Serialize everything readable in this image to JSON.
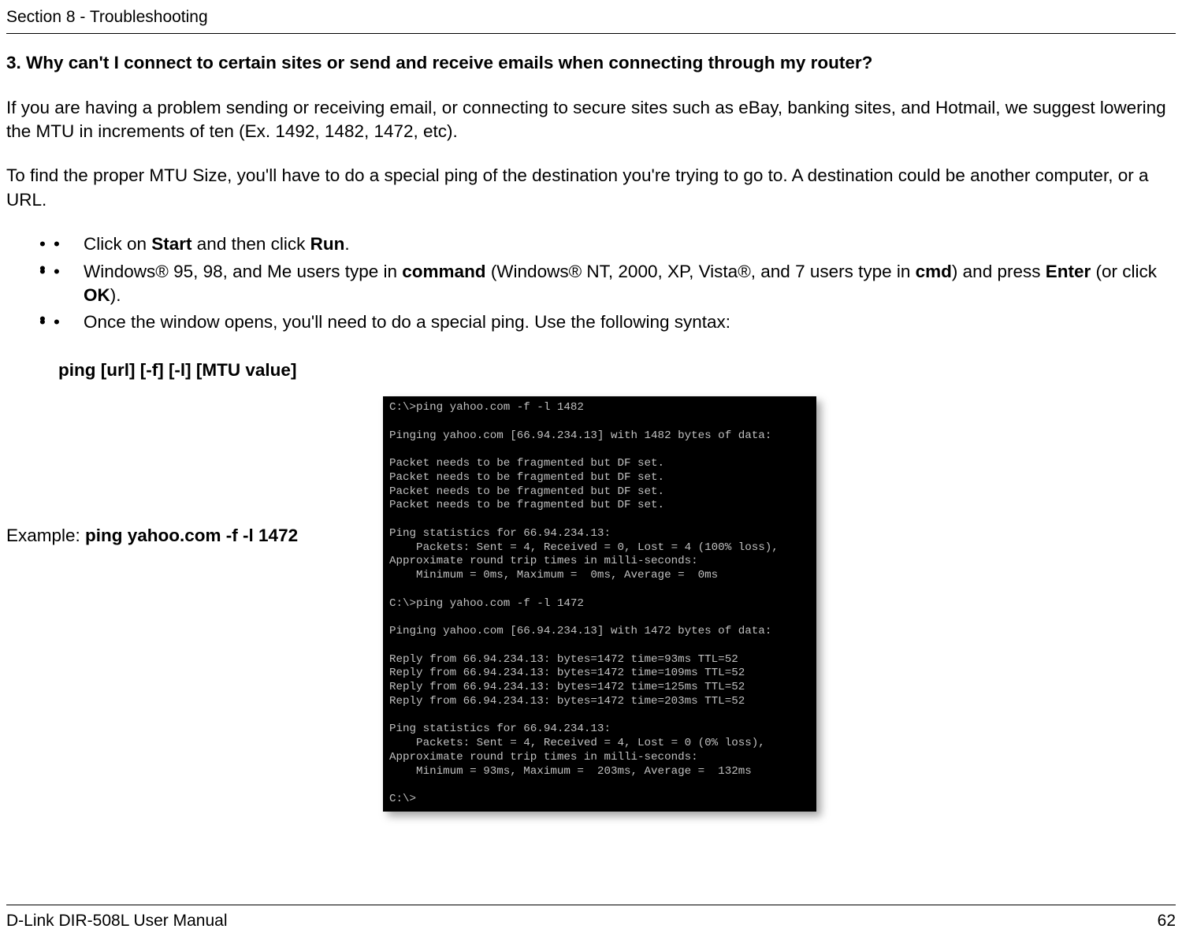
{
  "header": {
    "section": "Section 8 - Troubleshooting"
  },
  "question": "3. Why can't I connect to certain sites or send and receive emails when connecting through my router?",
  "para1": "If you are having a problem sending or receiving email, or connecting to secure sites such as eBay, banking sites, and Hotmail, we suggest lowering the MTU in increments of ten (Ex. 1492, 1482, 1472, etc).",
  "para2": "To find the proper MTU Size, you'll have to do a special ping of the destination you're trying to go to. A destination could be another computer, or a URL.",
  "bullets": {
    "b1_pre": "Click on ",
    "b1_start": "Start",
    "b1_mid": " and then click ",
    "b1_run": "Run",
    "b1_post": ".",
    "b2_pre": "Windows® 95, 98, and Me users type in ",
    "b2_cmd1": "command",
    "b2_mid": " (Windows® NT, 2000, XP, Vista®, and 7 users type in ",
    "b2_cmd2": "cmd",
    "b2_post1": ") and press ",
    "b2_enter": "Enter",
    "b2_or": " (or click ",
    "b2_ok": "OK",
    "b2_post2": ").",
    "b3": "Once the window opens, you'll need to do a special ping. Use the following syntax:"
  },
  "syntax": "ping [url] [-f] [-l] [MTU value]",
  "example_label": "Example: ",
  "example_cmd": "ping yahoo.com -f -l 1472",
  "terminal": "C:\\>ping yahoo.com -f -l 1482\n\nPinging yahoo.com [66.94.234.13] with 1482 bytes of data:\n\nPacket needs to be fragmented but DF set.\nPacket needs to be fragmented but DF set.\nPacket needs to be fragmented but DF set.\nPacket needs to be fragmented but DF set.\n\nPing statistics for 66.94.234.13:\n    Packets: Sent = 4, Received = 0, Lost = 4 (100% loss),\nApproximate round trip times in milli-seconds:\n    Minimum = 0ms, Maximum =  0ms, Average =  0ms\n\nC:\\>ping yahoo.com -f -l 1472\n\nPinging yahoo.com [66.94.234.13] with 1472 bytes of data:\n\nReply from 66.94.234.13: bytes=1472 time=93ms TTL=52\nReply from 66.94.234.13: bytes=1472 time=109ms TTL=52\nReply from 66.94.234.13: bytes=1472 time=125ms TTL=52\nReply from 66.94.234.13: bytes=1472 time=203ms TTL=52\n\nPing statistics for 66.94.234.13:\n    Packets: Sent = 4, Received = 4, Lost = 0 (0% loss),\nApproximate round trip times in milli-seconds:\n    Minimum = 93ms, Maximum =  203ms, Average =  132ms\n\nC:\\>",
  "footer": {
    "left": "D-Link DIR-508L User Manual",
    "right": "62"
  }
}
